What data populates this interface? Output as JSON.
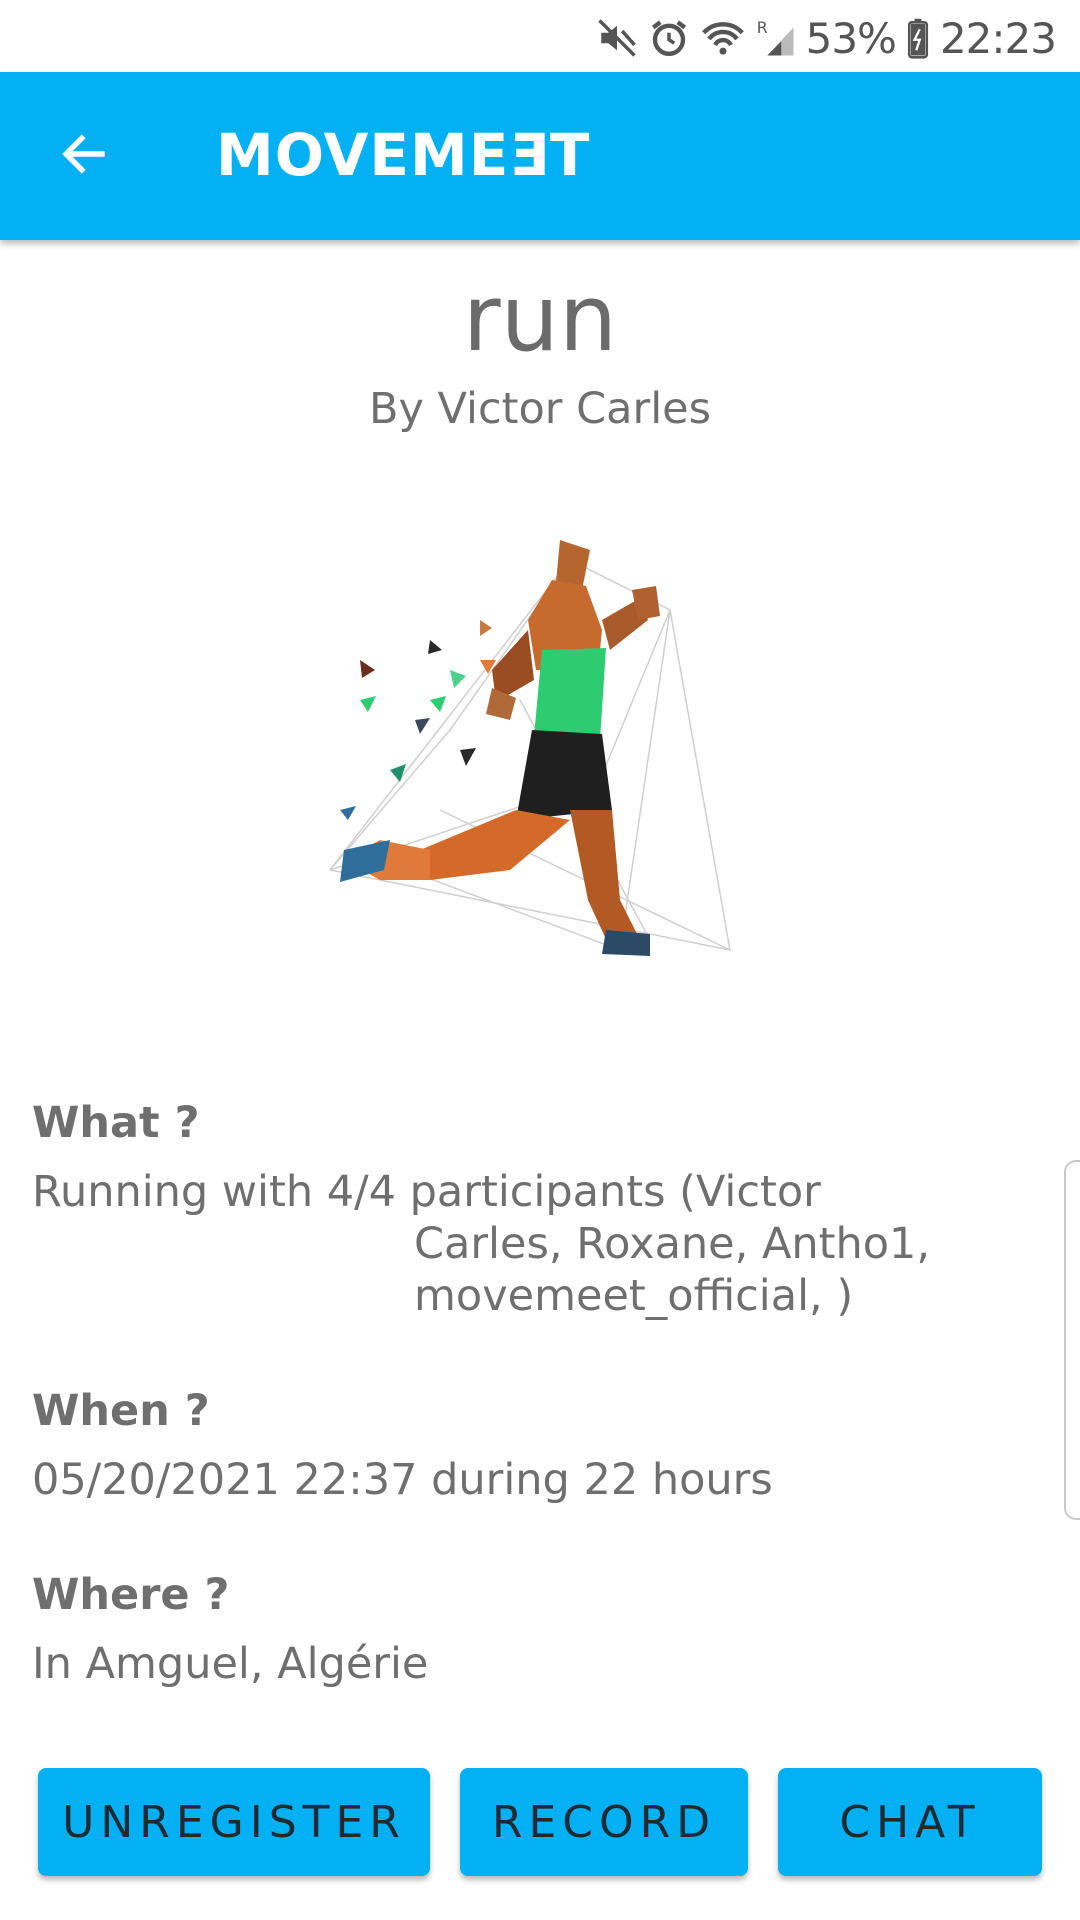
{
  "status_bar": {
    "battery": "53%",
    "time": "22:23",
    "icons": [
      "mute-icon",
      "alarm-icon",
      "wifi-icon",
      "roaming-signal-icon",
      "battery-charging-icon"
    ]
  },
  "app_bar": {
    "title": "MOVEMEƎT",
    "back_icon": "arrow-left-icon",
    "color": "#03b0f3"
  },
  "event": {
    "title": "run",
    "author_line": "By  Victor Carles",
    "image": "low-poly-runner-illustration"
  },
  "details": {
    "what_label": "What ?",
    "what_value_line1": "Running with 4/4 participants (Victor",
    "what_value_line2": "Carles, Roxane, Antho1,",
    "what_value_line3": "movemeet_official, )",
    "when_label": "When ?",
    "when_value": "05/20/2021 22:37 during 22 hours",
    "where_label": "Where ?",
    "where_value": "In Amguel, Algérie"
  },
  "actions": {
    "unregister_label": "UNREGISTER",
    "record_label": "RECORD",
    "chat_label": "CHAT"
  }
}
